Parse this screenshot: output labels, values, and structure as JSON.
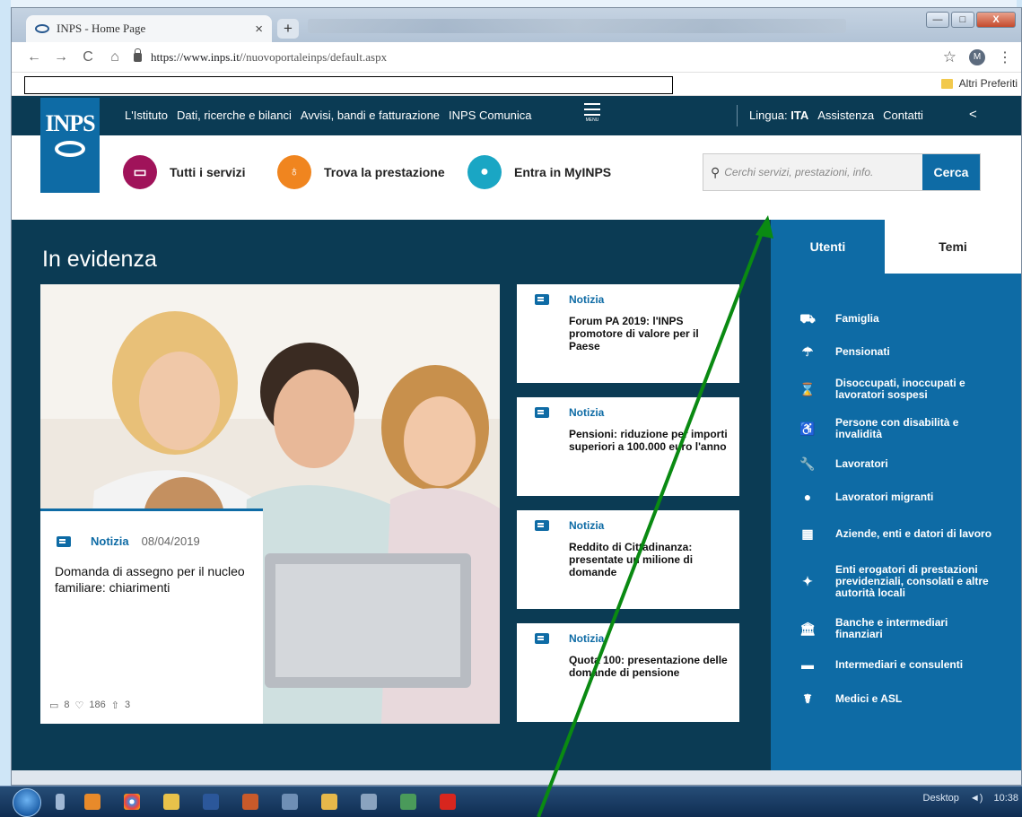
{
  "browser": {
    "tab_title": "INPS - Home Page",
    "tab_close": "×",
    "new_tab": "+",
    "url_host": "https://www.inps.it/",
    "url_path": "/nuovoportaleinps/default.aspx",
    "back": "←",
    "forward": "→",
    "reload": "C",
    "home": "⌂",
    "star": "☆",
    "profile_initial": "M",
    "menu": "⋮",
    "bookmark_folder": "Altri Preferiti",
    "win_min": "—",
    "win_max": "□",
    "win_close": "X"
  },
  "site": {
    "logo_text": "INPS",
    "nav": [
      "L'Istituto",
      "Dati, ricerche e bilanci",
      "Avvisi, bandi e fatturazione",
      "INPS Comunica"
    ],
    "menu_label": "MENU",
    "lingua_label": "Lingua:",
    "lingua_value": "ITA",
    "assistenza": "Assistenza",
    "contatti": "Contatti",
    "services": {
      "tutti": "Tutti i servizi",
      "trova": "Trova la prestazione",
      "entra": "Entra in MyINPS"
    },
    "search_placeholder": "Cerchi servizi, prestazioni, info.",
    "search_button": "Cerca",
    "in_evidenza": "In evidenza",
    "main_news": {
      "tag": "Notizia",
      "date": "08/04/2019",
      "title": "Domanda di assegno per il nucleo familiare: chiarimenti",
      "comments": "8",
      "likes": "186",
      "shares": "3"
    },
    "news": [
      {
        "tag": "Notizia",
        "title": "Forum PA 2019: l'INPS promotore di valore per il Paese"
      },
      {
        "tag": "Notizia",
        "title": "Pensioni: riduzione per importi superiori a 100.000 euro l'anno"
      },
      {
        "tag": "Notizia",
        "title": "Reddito di Cittadinanza: presentate un milione di domande"
      },
      {
        "tag": "Notizia",
        "title": "Quota 100: presentazione delle domande di pensione"
      }
    ],
    "side_tabs": {
      "utenti": "Utenti",
      "temi": "Temi"
    },
    "side_items": [
      {
        "label": "Famiglia",
        "icon": "stroller-icon",
        "glyph": "⛟"
      },
      {
        "label": "Pensionati",
        "icon": "umbrella-icon",
        "glyph": "☂"
      },
      {
        "label": "Disoccupati, inoccupati e lavoratori sospesi",
        "icon": "hourglass-icon",
        "glyph": "⌛"
      },
      {
        "label": "Persone con disabilità e invalidità",
        "icon": "wheelchair-icon",
        "glyph": "♿"
      },
      {
        "label": "Lavoratori",
        "icon": "wrench-icon",
        "glyph": "🔧"
      },
      {
        "label": "Lavoratori migranti",
        "icon": "globe-icon",
        "glyph": "●"
      },
      {
        "label": "Aziende, enti e datori di lavoro",
        "icon": "building-icon",
        "glyph": "▦"
      },
      {
        "label": "Enti erogatori di prestazioni previdenziali, consolati e altre autorità locali",
        "icon": "handshake-icon",
        "glyph": "✦"
      },
      {
        "label": "Banche e intermediari finanziari",
        "icon": "bank-icon",
        "glyph": "🏛"
      },
      {
        "label": "Intermediari e consulenti",
        "icon": "briefcase-icon",
        "glyph": "▬"
      },
      {
        "label": "Medici e ASL",
        "icon": "stethoscope-icon",
        "glyph": "☤"
      }
    ]
  },
  "taskbar": {
    "desktop": "Desktop",
    "time": "10:38"
  },
  "colors": {
    "inps_dark": "#0b3b54",
    "inps_blue": "#0e6ba5",
    "tutti_circle": "#a0135a",
    "trova_circle": "#f0851f",
    "entra_circle": "#1aa6c4",
    "annotation_arrow": "#0a8a12"
  }
}
